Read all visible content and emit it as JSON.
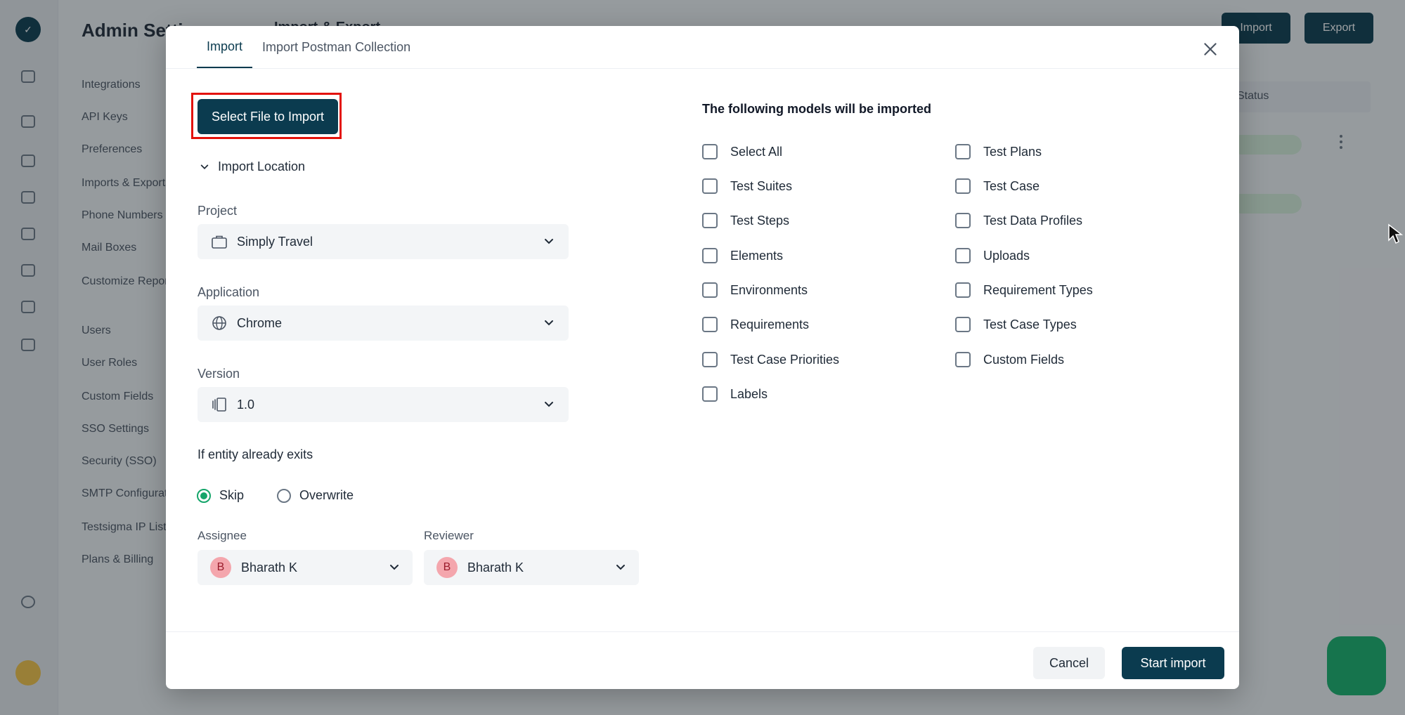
{
  "modal": {
    "tabs": [
      {
        "label": "Import",
        "active": true
      },
      {
        "label": "Import Postman Collection",
        "active": false
      }
    ],
    "select_file_label": "Select File to Import",
    "import_location": {
      "label": "Import Location",
      "project": {
        "label": "Project",
        "value": "Simply Travel",
        "icon": "briefcase-icon"
      },
      "application": {
        "label": "Application",
        "value": "Chrome",
        "icon": "globe-icon"
      },
      "version": {
        "label": "Version",
        "value": "1.0",
        "icon": "versions-icon"
      }
    },
    "entity_exists": {
      "label": "If entity already exits",
      "options": [
        {
          "label": "Skip",
          "selected": true
        },
        {
          "label": "Overwrite",
          "selected": false
        }
      ]
    },
    "assignee": {
      "label": "Assignee",
      "value": "Bharath K",
      "initial": "B"
    },
    "reviewer": {
      "label": "Reviewer",
      "value": "Bharath K",
      "initial": "B"
    },
    "models": {
      "title": "The following models will be imported",
      "left": [
        "Select All",
        "Test Suites",
        "Test Steps",
        "Elements",
        "Environments",
        "Requirements",
        "Test Case Priorities",
        "Labels"
      ],
      "right": [
        "Test Plans",
        "Test Case",
        "Test Data Profiles",
        "Uploads",
        "Requirement Types",
        "Test Case Types",
        "Custom Fields"
      ]
    },
    "footer": {
      "cancel_label": "Cancel",
      "start_label": "Start import"
    }
  },
  "background": {
    "title": "Admin Settings",
    "subtitle": "Import & Export",
    "buttons": [
      "Import",
      "Export"
    ],
    "nav": [
      "Integrations",
      "API Keys",
      "Preferences",
      "Imports & Exports",
      "Phone Numbers",
      "Mail Boxes",
      "Customize Reports",
      "Users",
      "User Roles",
      "Custom Fields",
      "SSO Settings",
      "Security (SSO)",
      "SMTP Configuration",
      "Testsigma IP List",
      "Plans & Billing"
    ],
    "table_header": "Status"
  },
  "colors": {
    "primary": "#0b3b4f",
    "radio_selected": "#15a56a",
    "highlight": "#e3120b",
    "avatar_bg": "#f4a6ad"
  }
}
